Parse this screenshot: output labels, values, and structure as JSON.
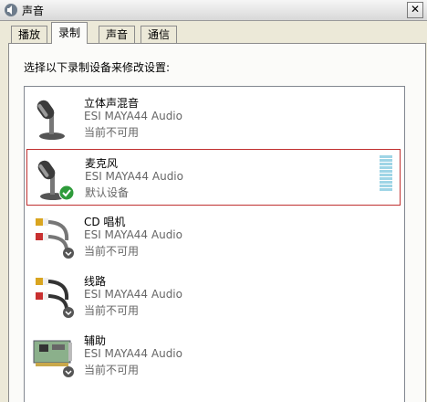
{
  "window": {
    "title": "声音",
    "close_symbol": "✕"
  },
  "tabs": [
    {
      "label": "播放",
      "active": false
    },
    {
      "label": "录制",
      "active": true
    },
    {
      "label": "声音",
      "active": false
    },
    {
      "label": "通信",
      "active": false
    }
  ],
  "instruction": "选择以下录制设备来修改设置:",
  "devices": [
    {
      "name": "立体声混音",
      "driver": "ESI MAYA44 Audio",
      "status": "当前不可用",
      "icon": "microphone-icon",
      "selected": false
    },
    {
      "name": "麦克风",
      "driver": "ESI MAYA44 Audio",
      "status": "默认设备",
      "icon": "microphone-icon",
      "selected": true,
      "default_badge": "check-badge-icon"
    },
    {
      "name": "CD 唱机",
      "driver": "ESI MAYA44 Audio",
      "status": "当前不可用",
      "icon": "rca-cable-icon",
      "selected": false
    },
    {
      "name": "线路",
      "driver": "ESI MAYA44 Audio",
      "status": "当前不可用",
      "icon": "rca-cable-icon",
      "selected": false
    },
    {
      "name": "辅助",
      "driver": "ESI MAYA44 Audio",
      "status": "当前不可用",
      "icon": "sound-card-icon",
      "selected": false
    }
  ]
}
